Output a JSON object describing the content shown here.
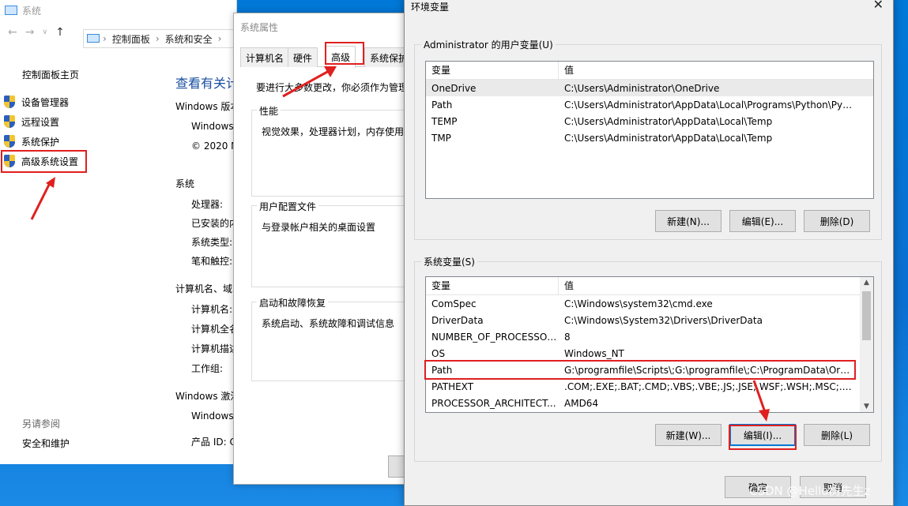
{
  "system": {
    "title": "系统",
    "breadcrumb": [
      "控制面板",
      "系统和安全"
    ],
    "home": "控制面板主页",
    "nav": [
      "设备管理器",
      "远程设置",
      "系统保护",
      "高级系统设置"
    ],
    "see_also": "另请参阅",
    "security": "安全和维护",
    "page_title": "查看有关计",
    "labels": [
      "Windows 版本",
      "Windows",
      "© 2020 M",
      "系统",
      "处理器:",
      "已安装的内",
      "系统类型:",
      "笔和触控:",
      "计算机名、域",
      "计算机名:",
      "计算机全名",
      "计算机描述",
      "工作组:",
      "Windows 激活",
      "Windows",
      "产品 ID: C"
    ]
  },
  "props": {
    "title": "系统属性",
    "tabs": [
      "计算机名",
      "硬件",
      "高级",
      "系统保护"
    ],
    "active_tab": 2,
    "description": "要进行大多数更改，你必须作为管理",
    "groups": [
      {
        "title": "性能",
        "text": "视觉效果，处理器计划，内存使用"
      },
      {
        "title": "用户配置文件",
        "text": "与登录帐户相关的桌面设置"
      },
      {
        "title": "启动和故障恢复",
        "text": "系统启动、系统故障和调试信息"
      }
    ]
  },
  "env": {
    "title": "环境变量",
    "user_frame": "Administrator 的用户变量(U)",
    "sys_frame": "系统变量(S)",
    "col_var": "变量",
    "col_val": "值",
    "user_vars": [
      {
        "name": "OneDrive",
        "value": "C:\\Users\\Administrator\\OneDrive"
      },
      {
        "name": "Path",
        "value": "C:\\Users\\Administrator\\AppData\\Local\\Programs\\Python\\Pyt..."
      },
      {
        "name": "TEMP",
        "value": "C:\\Users\\Administrator\\AppData\\Local\\Temp"
      },
      {
        "name": "TMP",
        "value": "C:\\Users\\Administrator\\AppData\\Local\\Temp"
      }
    ],
    "sys_vars": [
      {
        "name": "ComSpec",
        "value": "C:\\Windows\\system32\\cmd.exe"
      },
      {
        "name": "DriverData",
        "value": "C:\\Windows\\System32\\Drivers\\DriverData"
      },
      {
        "name": "NUMBER_OF_PROCESSORS",
        "value": "8"
      },
      {
        "name": "OS",
        "value": "Windows_NT"
      },
      {
        "name": "Path",
        "value": "G:\\programfile\\Scripts\\;G:\\programfile\\;C:\\ProgramData\\Ora..."
      },
      {
        "name": "PATHEXT",
        "value": ".COM;.EXE;.BAT;.CMD;.VBS;.VBE;.JS;.JSE;.WSF;.WSH;.MSC;.PY;.P..."
      },
      {
        "name": "PROCESSOR_ARCHITECT...",
        "value": "AMD64"
      }
    ],
    "user_buttons": {
      "new": "新建(N)...",
      "edit": "编辑(E)...",
      "delete": "删除(D)"
    },
    "sys_buttons": {
      "new": "新建(W)...",
      "edit": "编辑(I)...",
      "delete": "删除(L)"
    },
    "ok": "确定",
    "cancel": "取消"
  },
  "watermark": "CSDN @Hello树先生z",
  "colors": {
    "highlight": "#e0201f",
    "accent": "#0078d7"
  }
}
